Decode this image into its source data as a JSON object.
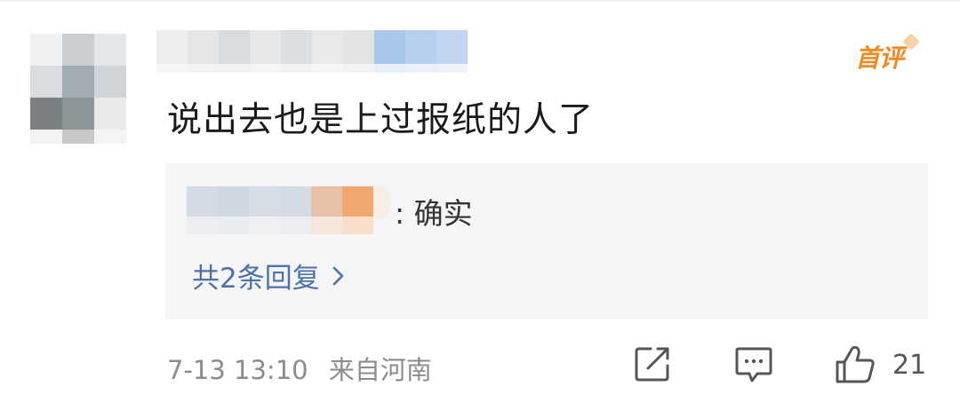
{
  "comment": {
    "badge": "首评",
    "text": "说出去也是上过报纸的人了",
    "reply_preview": {
      "separator_text": ": 确实"
    },
    "reply_more": "共2条回复",
    "timestamp": "7-13 13:10",
    "location": "来自河南",
    "like_count": "21"
  },
  "colors": {
    "badge": "#f08a24",
    "link": "#4c73a8",
    "meta": "#8c8c8c",
    "reply_bg": "#f5f5f7"
  },
  "icons": {
    "share": "share-icon",
    "comment": "comment-icon",
    "like": "thumbs-up-icon",
    "chevron": "chevron-right-icon"
  }
}
